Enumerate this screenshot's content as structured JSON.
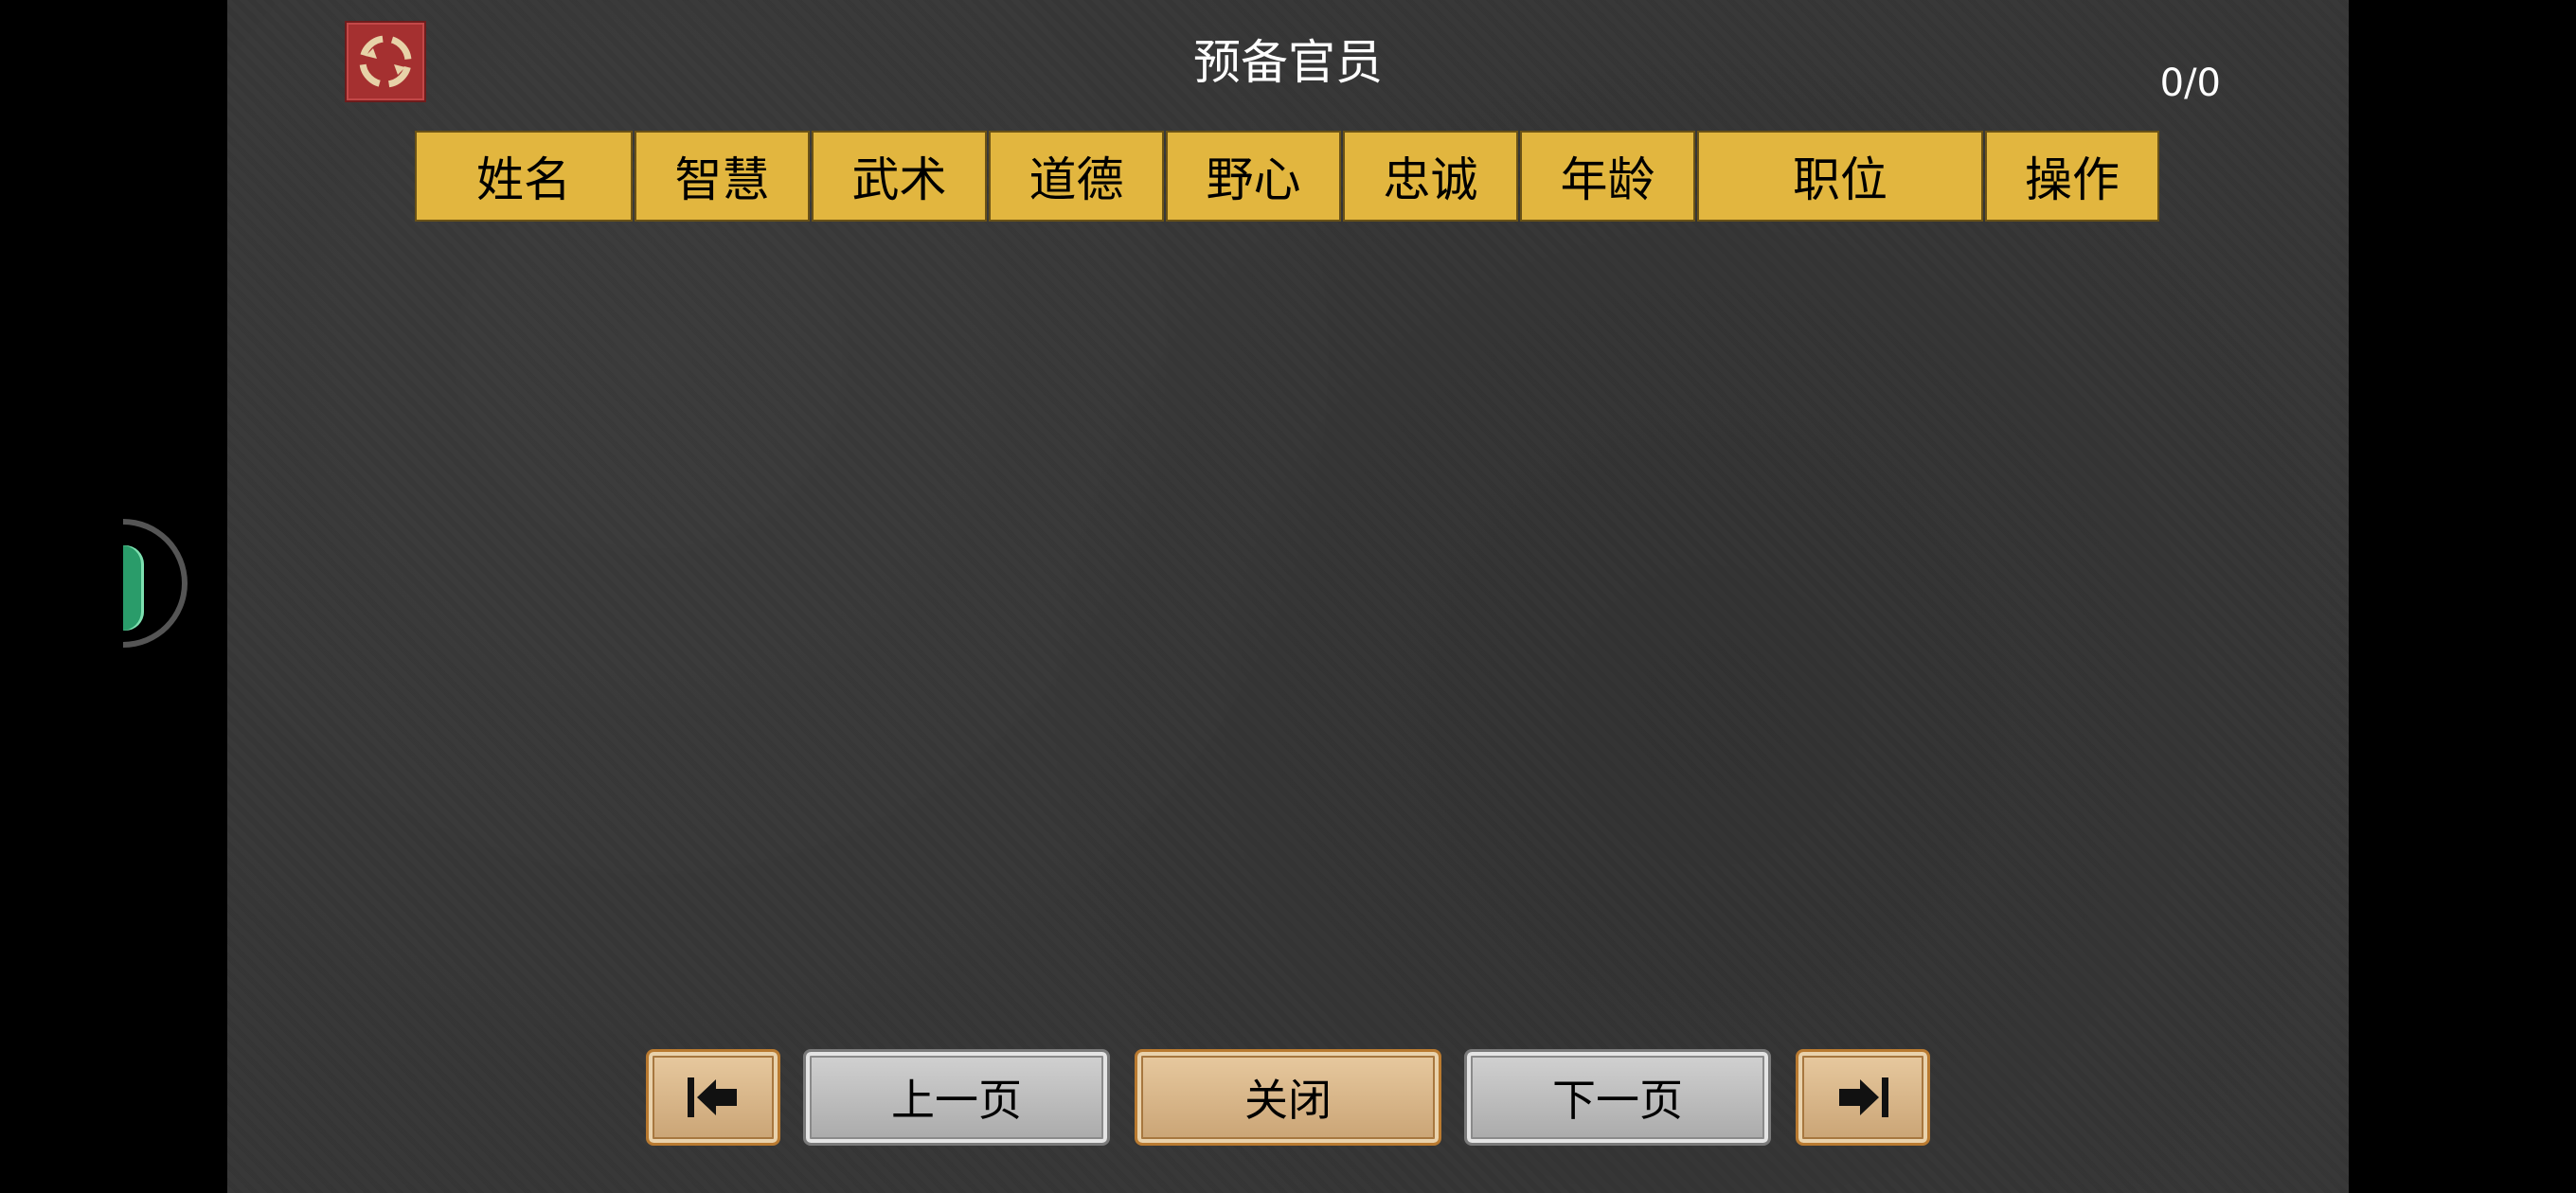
{
  "dialog": {
    "title": "预备官员",
    "page_count": "0/0"
  },
  "table": {
    "columns": [
      "姓名",
      "智慧",
      "武术",
      "道德",
      "野心",
      "忠诚",
      "年龄",
      "职位",
      "操作"
    ],
    "rows": []
  },
  "footer": {
    "first_icon": "first-page-arrow-icon",
    "prev_label": "上一页",
    "close_label": "关闭",
    "next_label": "下一页",
    "last_icon": "last-page-arrow-icon"
  },
  "colors": {
    "panel_bg": "#363636",
    "header_cell": "#e2b63f",
    "refresh_button": "#a53030"
  },
  "icons": {
    "refresh": "refresh-icon",
    "side_widget": "assistive-widget-icon"
  }
}
